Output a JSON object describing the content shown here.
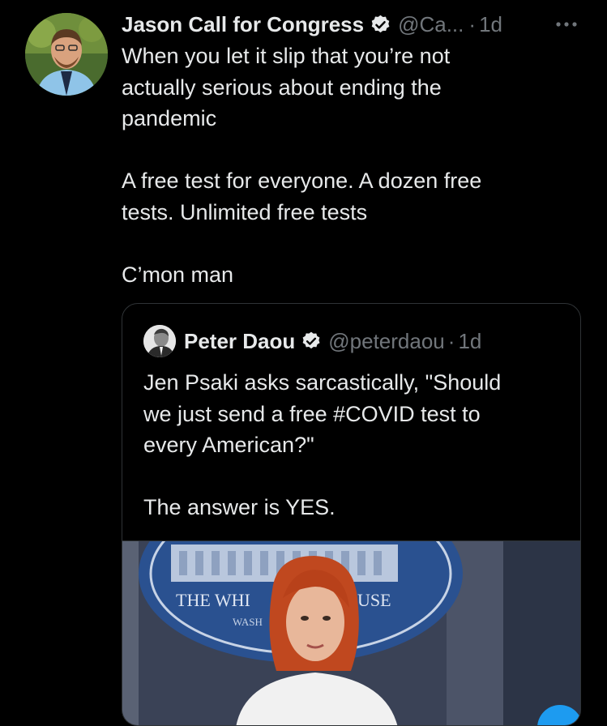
{
  "tweet": {
    "author_name": "Jason Call for Congress",
    "handle": "@Ca...",
    "separator": "·",
    "time": "1d",
    "more_label": "More",
    "text_lines": [
      "When you let it slip that you’re not",
      "actually serious about ending the",
      "pandemic",
      "",
      "A free test for everyone. A dozen free",
      "tests. Unlimited free tests",
      "",
      "C’mon man"
    ]
  },
  "quoted_tweet": {
    "author_name": "Peter Daou",
    "handle": "@peterdaou",
    "separator": "·",
    "time": "1d",
    "text_lines": [
      "Jen Psaki asks sarcastically, \"Should",
      "we just send a free #COVID test to",
      "every American?\"",
      "",
      "The answer is YES."
    ],
    "media": {
      "seal_text_top": "THE WHI",
      "seal_text_right": "USE",
      "seal_text_small": "WASH"
    }
  },
  "colors": {
    "background": "#000000",
    "text": "#e7e9ea",
    "secondary": "#71767b",
    "border": "#2f3336",
    "verified": "#e7e9ea"
  },
  "icons": {
    "verified": "verified-badge-icon",
    "more": "more-horizontal-icon"
  }
}
